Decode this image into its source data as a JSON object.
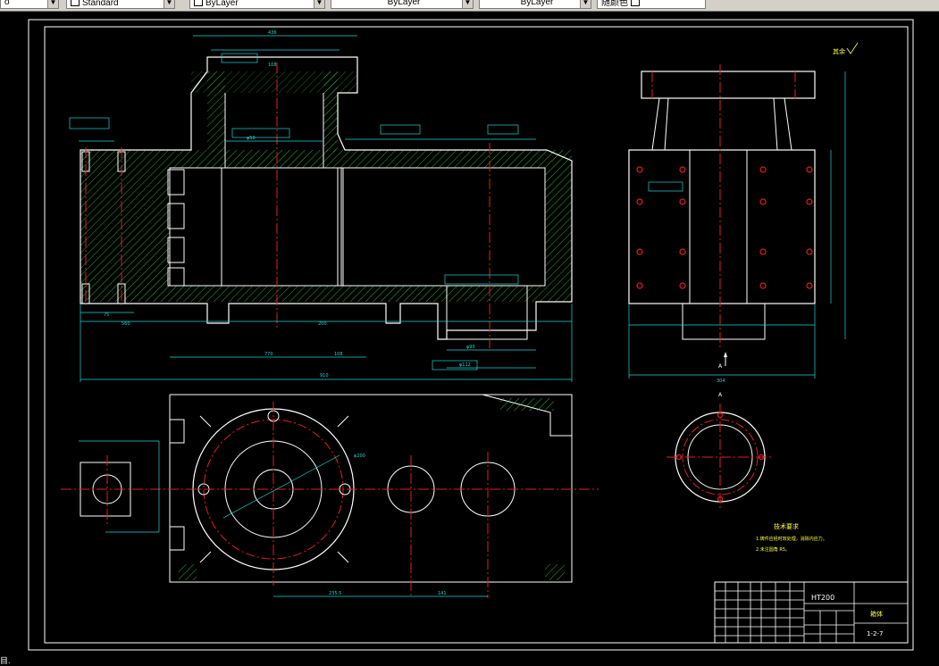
{
  "toolbar": {
    "left_combo": "o",
    "style_combo": "Standard",
    "layer_combo": "ByLayer",
    "linetype_combo": "ByLayer",
    "lineweight_combo": "ByLayer",
    "plot_combo": "随颜色"
  },
  "drawing": {
    "surface_finish": "其余",
    "section_label_top": "A",
    "section_label_bottom": "A",
    "dim_overall_length": "910",
    "dim_right_width": "304",
    "tech_req_title": "技术要求",
    "tech_req_line1": "1.铸件应经时效处理，消除内应力。",
    "tech_req_line2": "2.未注圆角 R5。",
    "title_material": "HT200",
    "title_part_name": "箱体",
    "title_drawing_no": "1-2-7"
  },
  "status": {
    "text": "目."
  }
}
